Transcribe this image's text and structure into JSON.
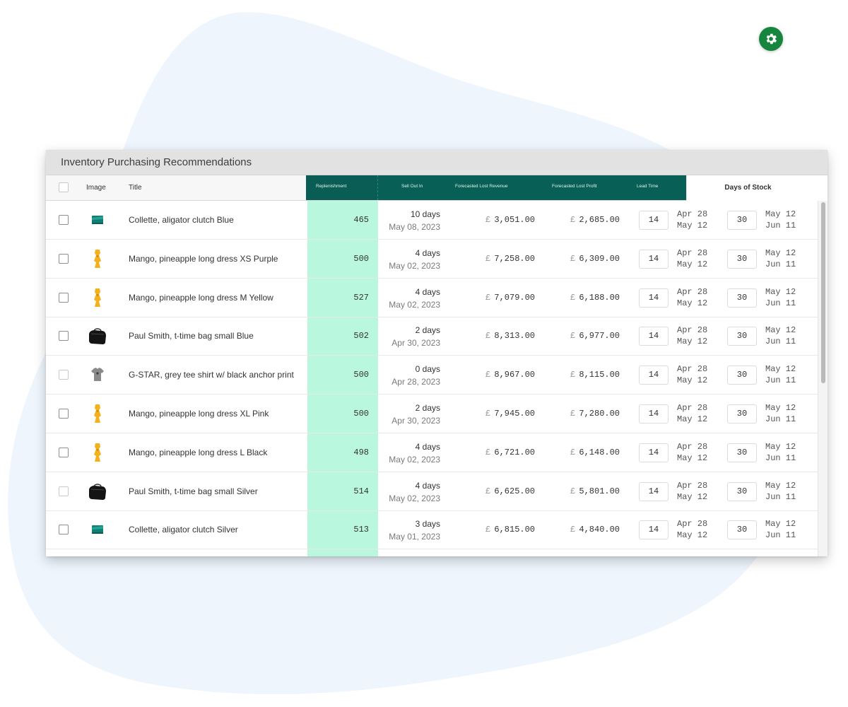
{
  "window_title": "Inventory Purchasing Recommendations",
  "headers": {
    "image": "Image",
    "title": "Title",
    "replenishment": "Replenishment",
    "sell_out_in": "Sell Out In",
    "forecasted_lost_revenue": "Forecasted Lost Revenue",
    "forecasted_lost_profit": "Forecasted Lost Profit",
    "lead_time": "Lead Time",
    "days_of_stock": "Days of Stock"
  },
  "settings_icon": "gear-icon",
  "currency_symbol": "£",
  "colors": {
    "header_teal": "#075f56",
    "replenishment_highlight": "#b9f7df",
    "settings_green": "#16853e"
  },
  "rows": [
    {
      "image": "clutch-icon",
      "title": "Collette, aligator clutch Blue",
      "replenishment": "465",
      "sell_days": "10 days",
      "sell_date": "May 08, 2023",
      "lost_revenue": "3,051.00",
      "lost_profit": "2,685.00",
      "lead_time": "14",
      "lead_date1": "Apr 28",
      "lead_date2": "May 12",
      "stock_days": "30",
      "stock_date1": "May 12",
      "stock_date2": "Jun 11"
    },
    {
      "image": "dress-icon",
      "title": "Mango, pineapple long dress XS Purple",
      "replenishment": "500",
      "sell_days": "4 days",
      "sell_date": "May 02, 2023",
      "lost_revenue": "7,258.00",
      "lost_profit": "6,309.00",
      "lead_time": "14",
      "lead_date1": "Apr 28",
      "lead_date2": "May 12",
      "stock_days": "30",
      "stock_date1": "May 12",
      "stock_date2": "Jun 11"
    },
    {
      "image": "dress-icon",
      "title": "Mango, pineapple long dress M Yellow",
      "replenishment": "527",
      "sell_days": "4 days",
      "sell_date": "May 02, 2023",
      "lost_revenue": "7,079.00",
      "lost_profit": "6,188.00",
      "lead_time": "14",
      "lead_date1": "Apr 28",
      "lead_date2": "May 12",
      "stock_days": "30",
      "stock_date1": "May 12",
      "stock_date2": "Jun 11"
    },
    {
      "image": "bag-icon",
      "title": "Paul Smith, t-time bag small Blue",
      "replenishment": "502",
      "sell_days": "2 days",
      "sell_date": "Apr 30, 2023",
      "lost_revenue": "8,313.00",
      "lost_profit": "6,977.00",
      "lead_time": "14",
      "lead_date1": "Apr 28",
      "lead_date2": "May 12",
      "stock_days": "30",
      "stock_date1": "May 12",
      "stock_date2": "Jun 11"
    },
    {
      "image": "tshirt-icon",
      "title": "G-STAR, grey tee shirt w/ black anchor print",
      "replenishment": "500",
      "sell_days": "0 days",
      "sell_date": "Apr 28, 2023",
      "lost_revenue": "8,967.00",
      "lost_profit": "8,115.00",
      "lead_time": "14",
      "lead_date1": "Apr 28",
      "lead_date2": "May 12",
      "stock_days": "30",
      "stock_date1": "May 12",
      "stock_date2": "Jun 11"
    },
    {
      "image": "dress-icon",
      "title": "Mango, pineapple long dress XL Pink",
      "replenishment": "500",
      "sell_days": "2 days",
      "sell_date": "Apr 30, 2023",
      "lost_revenue": "7,945.00",
      "lost_profit": "7,280.00",
      "lead_time": "14",
      "lead_date1": "Apr 28",
      "lead_date2": "May 12",
      "stock_days": "30",
      "stock_date1": "May 12",
      "stock_date2": "Jun 11"
    },
    {
      "image": "dress-icon",
      "title": "Mango, pineapple long dress L Black",
      "replenishment": "498",
      "sell_days": "4 days",
      "sell_date": "May 02, 2023",
      "lost_revenue": "6,721.00",
      "lost_profit": "6,148.00",
      "lead_time": "14",
      "lead_date1": "Apr 28",
      "lead_date2": "May 12",
      "stock_days": "30",
      "stock_date1": "May 12",
      "stock_date2": "Jun 11"
    },
    {
      "image": "bag-icon",
      "title": "Paul Smith, t-time bag small Silver",
      "replenishment": "514",
      "sell_days": "4 days",
      "sell_date": "May 02, 2023",
      "lost_revenue": "6,625.00",
      "lost_profit": "5,801.00",
      "lead_time": "14",
      "lead_date1": "Apr 28",
      "lead_date2": "May 12",
      "stock_days": "30",
      "stock_date1": "May 12",
      "stock_date2": "Jun 11"
    },
    {
      "image": "clutch-icon",
      "title": "Collette, aligator clutch Silver",
      "replenishment": "513",
      "sell_days": "3 days",
      "sell_date": "May 01, 2023",
      "lost_revenue": "6,815.00",
      "lost_profit": "4,840.00",
      "lead_time": "14",
      "lead_date1": "Apr 28",
      "lead_date2": "May 12",
      "stock_days": "30",
      "stock_date1": "May 12",
      "stock_date2": "Jun 11"
    }
  ]
}
